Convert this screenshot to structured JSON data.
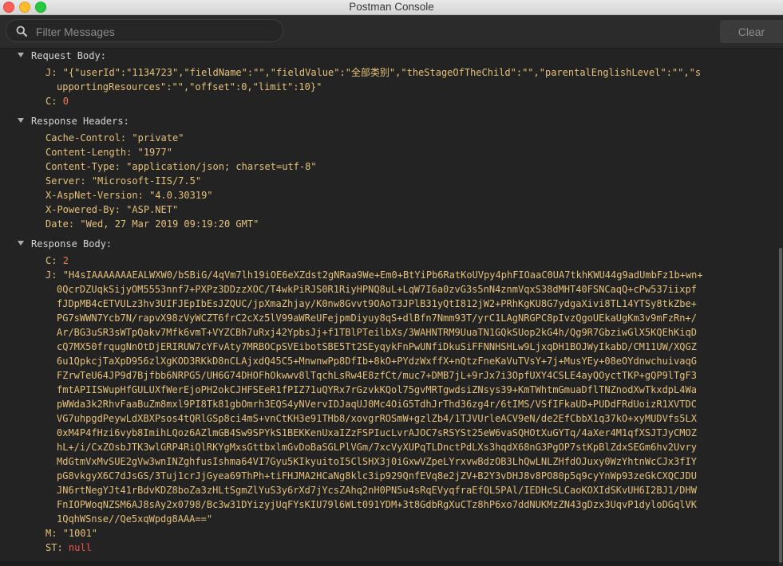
{
  "window": {
    "title": "Postman Console"
  },
  "toolbar": {
    "filter_placeholder": "Filter Messages",
    "clear_label": "Clear"
  },
  "request_body": {
    "header": "Request Body:",
    "j_key": "J:",
    "j_line1": "\"{\"userId\":\"1134723\",\"fieldName\":\"\",\"fieldValue\":\"全部类别\",\"theStageOfTheChild\":\"\",\"parentalEnglishLevel\":\"\",\"s",
    "j_line2": "upportingResources\":\"\",\"offset\":0,\"limit\":10}\"",
    "c_key": "C:",
    "c_val": "0"
  },
  "response_headers": {
    "header": "Response Headers:",
    "items": [
      {
        "key": "Cache-Control:",
        "value": "\"private\""
      },
      {
        "key": "Content-Length:",
        "value": "\"1977\""
      },
      {
        "key": "Content-Type:",
        "value": "\"application/json; charset=utf-8\""
      },
      {
        "key": "Server:",
        "value": "\"Microsoft-IIS/7.5\""
      },
      {
        "key": "X-AspNet-Version:",
        "value": "\"4.0.30319\""
      },
      {
        "key": "X-Powered-By:",
        "value": "\"ASP.NET\""
      },
      {
        "key": "Date:",
        "value": "\"Wed, 27 Mar 2019 09:19:20 GMT\""
      }
    ]
  },
  "response_body": {
    "header": "Response Body:",
    "c_key": "C:",
    "c_val": "2",
    "j_key": "J:",
    "j_lines": [
      "\"H4sIAAAAAAAEALWXW0/bSBiG/4qVm7lh19iOE6eXZdst2gNRaa9We+Em0+BtYiPb6RatKoUVpy4phFIOaaC0UA7tkhKWU44g9adUmbFz1b+wn+",
      "0QcrDZUqkSijyOM5553nnf7+PXPz3DDzzXOC/T4wkPiRJS0R1RiyHPNQ8uL+LqW7I6a0zvG3s5nN4znmVqxS38dMHT40FSNCaqQ+cPw537iixpf",
      "fJDpMB4cETVULz3hv3UIFJEpIbEsJZQUC/jpXmaZhjay/K0nw8Gvvt9OAoT3JPlB31yQtI812jW2+PRhKgKU8G7ydgaXivi8TL14YTSy8tkZbe+",
      "PG7sWWN7Ycb7N/rapvX98zVyWCZT6frC2cXz5lV99aWReUFejpmDiyuy8qS+dlBfn7Nmm93T/yrC1LAgNRGPC8pIvzQgoUEkaUgKm3v9mFzRn+/",
      "Ar/BG3uSR3sWTpQakv7Mfk6vmT+VYZCBh7uRxj42YpbsJj+f1TBlPTeilbXs/3WAHNTRM9UuaTN1GQkSUop2kG4h/Qg9R7GbziwGlX5KQEhKiqD",
      "cQ7MX50frqugNnOtDjERIRUW7cYFvAty7MRBOCpSVEibotSBE5Tt2SEyqykFnPwUNfiDkuSiFFNNHSHLw9LjxqDH1BOJWyIkabD/CM11UW/XQGZ",
      "6u1QpkcjTaXpD956zlXgKOD3RKkD8nCLAjxdQ45C5+MnwnwPp8DfIb+8kO+PYdzWxffX+nQtzFneKaVuTVsY+7j+MusYEy+08eOYdnwchuivaqG",
      "FZrwTeU64JP9d7Bjfbb6NRPG5/UH6G74DHOFhOkwwv8lTqchLsRw4E8zfCt/muc7+DMB7jL+9rJx7i3OpfUXY4CSLE4ayQOyctTKP+gQP9lTgF3",
      "fmtAPIISWupHfGULUXfWerEjoPH2okCJHFSEeR1fPIZ71uQYRx7rGzvkKQol75gvMRTgwdsiZNsys39+KmTWhtmGmuaDflTNZnodXwTkxdpL4Wa",
      "pWWda3k2RhvFaaBuZm8mxl9PI8Tk81gbOmrh3EQS4yNVervIDJaqUJ0Mc4OiG5TdhJrThd36zg4r/6tIMS/VSfIFkaUD+PUDdFRdUoizR1XVTDC",
      "VG7uhpgdPeywLdXBXPsos4tQRlGSp8ci4mS+vnCtKH3e91THb8/xovgrROSmW+gzlZb4/1TJVUrleACV9eN/de2EfCbbX1q37kO+xyMUDVfs5LX",
      "0xM4P4fHzi6vyb8ImihLQoz6AZlmGB4Sw9SPYkS1BEKKenUxaIZzFSPIucLvrAJOC7sRSYSt25eW6vaSQHOtXuGYTq/4aXer4M1qfXSJTJyCMOZ",
      "hL+/i/CxZOsbJTK3wlGRP4RiQlRKYgMxsGttbxlmGvDoBaSGLPlVGm/7xcVyXUPqTLDnctPdLXs3hqdX68nG3PgOP7stKpBlZdxSEGm6hv2Uvry",
      "MdGtmVxMvSUE2gVw3wnINZghfusIshma64VI7Gyu5KIkyuitoI5ClSHX3j0iGxwVZpeLYrxvwBdzOB3LhQwLNLZHfdOJuxy0WzYhtnWcCJx3fIY",
      "pG8vkgyX6C7dJsGS/3Tuj1crJjGyea69ThPh+tiFHJMA2HCaNg8klc3ip929QnfEVq8e2jZV+B2Y3vDHJ8v8PO80p5q9cyYnWp93zeGkCXQCJDU",
      "JN6rtNegYJt41rBdvKDZ8boZa3zHLtSgmZlYuS3y6rXd7jYcsZAhq2nH0PN5u4sRqEVyqfraEfQL5PAl/IEDHcSLCaoKOXIdSKvUH6I2BJ1/DHW",
      "FnIOPWoqNZSM6AJ8sAy2x0798/Bc3w31DYizyjUqFYsKIU79l6WLt091YDM+3t8GdbRgXuCTz8hP6xo7ddNUKMzZN43gDzx3UqvP1dyloDGqlVK",
      "1QqhWSnse//Qe5xqWpdg8AAA==\""
    ],
    "m_key": "M:",
    "m_val": "\"1001\"",
    "st_key": "ST:",
    "st_val": "null"
  }
}
